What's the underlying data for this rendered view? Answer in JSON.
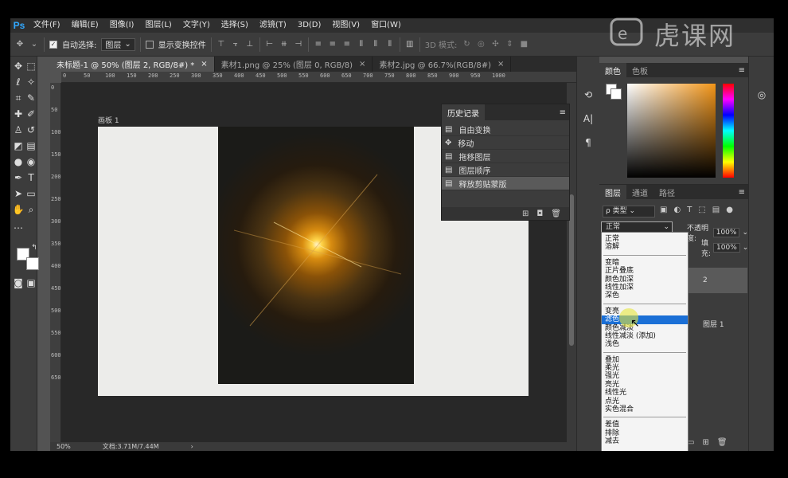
{
  "app": {
    "logo": "Ps"
  },
  "menu": [
    "文件(F)",
    "编辑(E)",
    "图像(I)",
    "图层(L)",
    "文字(Y)",
    "选择(S)",
    "滤镜(T)",
    "3D(D)",
    "视图(V)",
    "窗口(W)"
  ],
  "options": {
    "auto_select_label": "自动选择:",
    "auto_select_value": "图层",
    "transform_controls_label": "显示变换控件",
    "mode_3d_label": "3D 模式:"
  },
  "tabs": [
    {
      "label": "未标题-1 @ 50% (图层 2, RGB/8#) *",
      "close": "×"
    },
    {
      "label": "素材1.png @ 25% (图层 0, RGB/8)",
      "close": "×"
    },
    {
      "label": "素材2.jpg @ 66.7%(RGB/8#)",
      "close": "×"
    }
  ],
  "ruler": {
    "h": [
      "0",
      "50",
      "100",
      "150",
      "200",
      "250",
      "300",
      "350",
      "400",
      "450",
      "500",
      "550",
      "600",
      "650",
      "700",
      "750",
      "800",
      "850",
      "900",
      "950",
      "1000"
    ],
    "v": [
      "0",
      "50",
      "100",
      "150",
      "200",
      "250",
      "300",
      "350",
      "400",
      "450",
      "500",
      "550",
      "600",
      "650"
    ]
  },
  "canvas": {
    "artboard_label": "画板 1"
  },
  "status": {
    "zoom": "50%",
    "doc": "文档:3.71M/7.44M",
    "arrow": "›"
  },
  "history": {
    "title": "历史记录",
    "items": [
      "自由变换",
      "移动",
      "拖移图层",
      "图层顺序",
      "释放剪贴蒙版"
    ],
    "selected_index": 4
  },
  "color_panel": {
    "tabs": [
      "颜色",
      "色板"
    ]
  },
  "layers_panel": {
    "tabs": [
      "图层",
      "通道",
      "路径"
    ],
    "filter_label": "ρ 类型",
    "blend_mode": "正常",
    "opacity_label": "不透明度:",
    "opacity_value": "100%",
    "fill_label": "填充:",
    "fill_value": "100%",
    "layer_partial_1": "2",
    "layer_partial_2": "图层 1"
  },
  "blend_modes": [
    [
      "正常",
      "溶解"
    ],
    [
      "变暗",
      "正片叠底",
      "颜色加深",
      "线性加深",
      "深色"
    ],
    [
      "变亮",
      "滤色",
      "颜色减淡",
      "线性减淡 (添加)",
      "浅色"
    ],
    [
      "叠加",
      "柔光",
      "强光",
      "亮光",
      "线性光",
      "点光",
      "实色混合"
    ],
    [
      "差值",
      "排除",
      "减去"
    ]
  ],
  "blend_highlight": "滤色",
  "watermark": "虎课网",
  "colors": {
    "accent_highlight": "#1a6fd6",
    "ps_blue": "#31a8ff",
    "foreground_swatch": "#ffffff",
    "background_swatch": "#ffffff"
  }
}
